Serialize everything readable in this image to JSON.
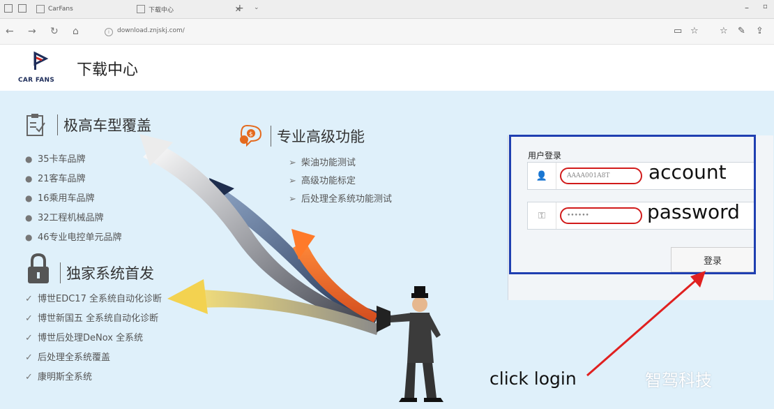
{
  "browser": {
    "tabs": [
      {
        "label": "CarFans"
      },
      {
        "label": "下载中心"
      }
    ],
    "url": "download.znjskj.com/"
  },
  "header": {
    "title": "下载中心",
    "brand": "CAR FANS"
  },
  "features": {
    "coverage": {
      "title": "极高车型覆盖",
      "items": [
        "35卡车品牌",
        "21客车品牌",
        "16乘用车品牌",
        "32工程机械品牌",
        "46专业电控单元品牌"
      ]
    },
    "advanced": {
      "title": "专业高级功能",
      "items": [
        "柴油功能测试",
        "高级功能标定",
        "后处理全系统功能测试"
      ]
    },
    "exclusive": {
      "title": "独家系统首发",
      "items": [
        "博世EDC17 全系统自动化诊断",
        "博世新国五 全系统自动化诊断",
        "博世后处理DeNox 全系统",
        "后处理全系统覆盖",
        "康明斯全系统"
      ]
    }
  },
  "login": {
    "label": "用户登录",
    "account_value": "AAAA001A8T",
    "password_value": "••••••",
    "button": "登录"
  },
  "annotations": {
    "account": "account",
    "password": "password",
    "click": "click login",
    "highlight_color": "#1f3fb1",
    "marker_color": "#e02020"
  },
  "watermark": "智驾科技",
  "colors": {
    "banner_bg": "#dff0fa",
    "brand_blue": "#1e2d5a",
    "brand_red": "#d9261c"
  }
}
